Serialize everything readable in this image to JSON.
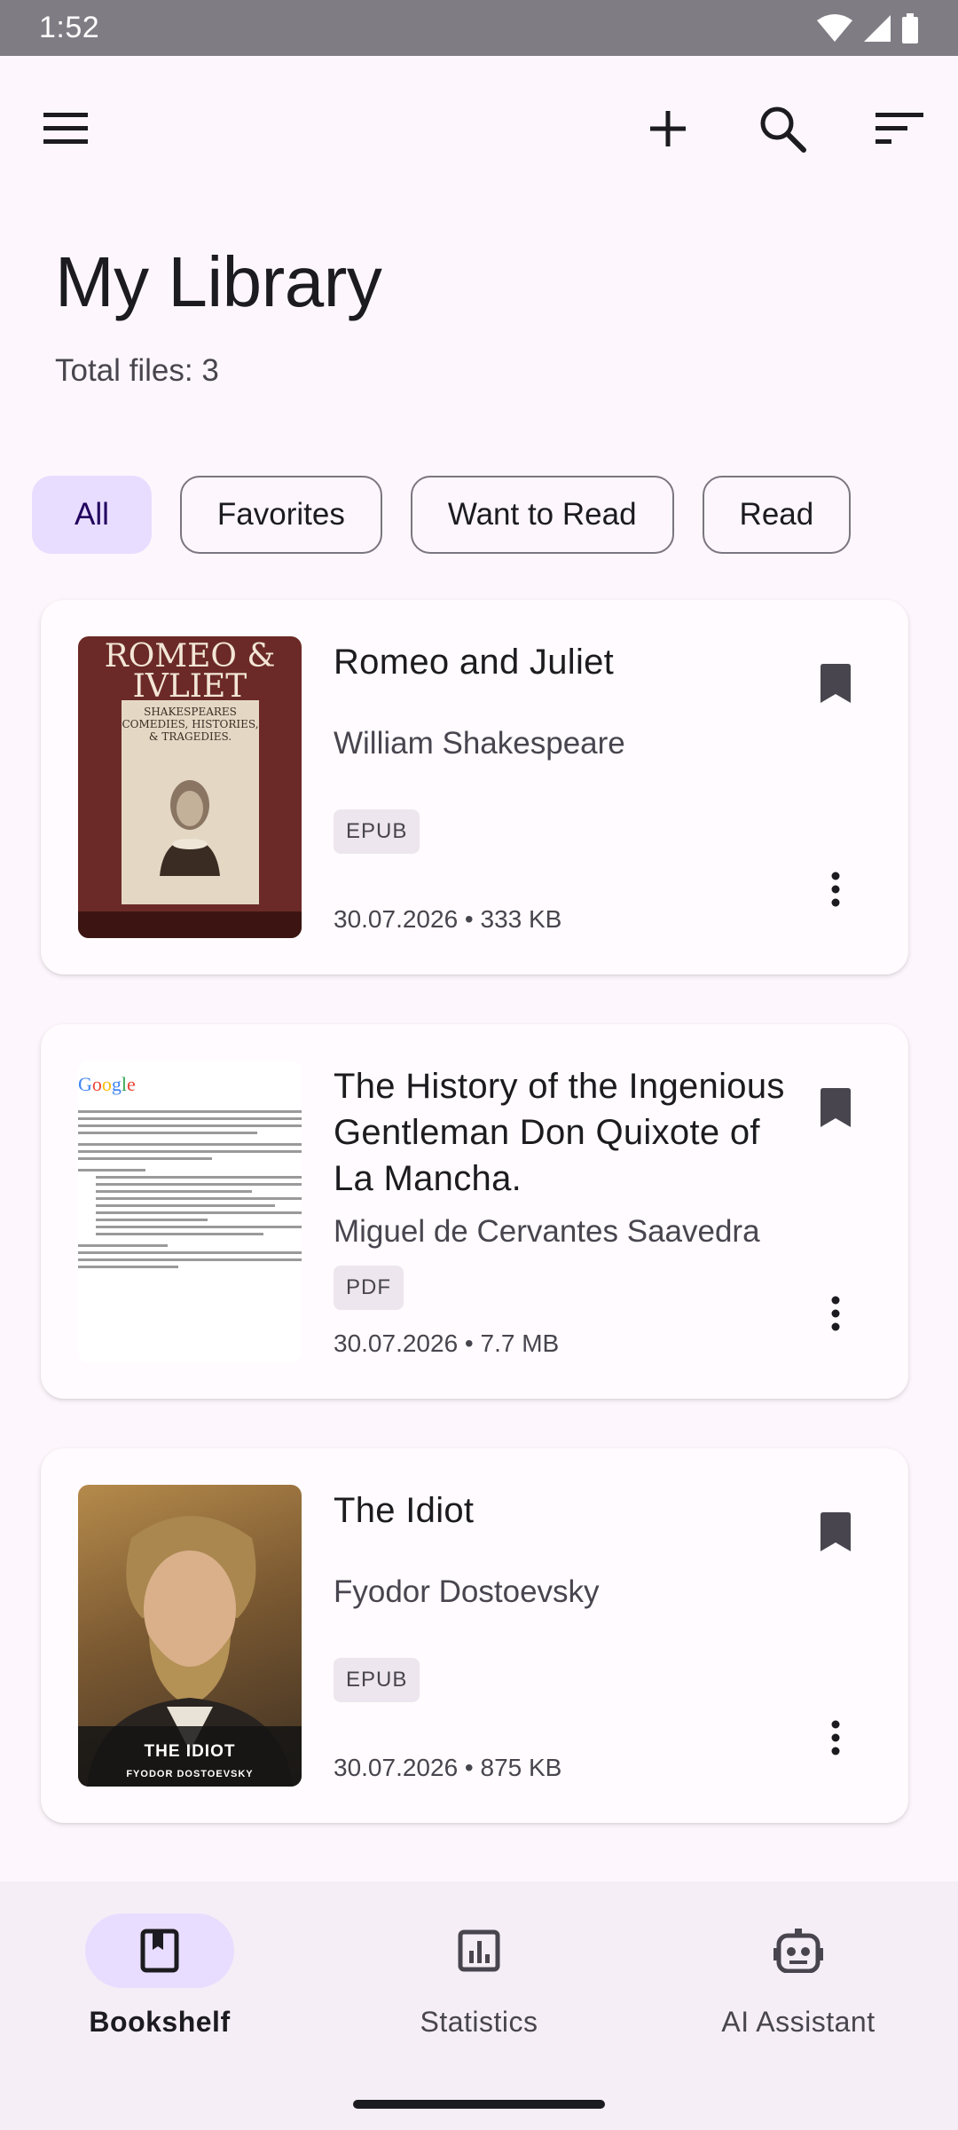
{
  "status_bar": {
    "time": "1:52"
  },
  "app_bar": {
    "menu_icon": "menu-icon",
    "add_icon": "add-icon",
    "search_icon": "search-icon",
    "sort_icon": "sort-icon"
  },
  "header": {
    "title": "My Library",
    "total_files": "Total files: 3"
  },
  "filters": [
    {
      "label": "All",
      "selected": true
    },
    {
      "label": "Favorites",
      "selected": false
    },
    {
      "label": "Want to Read",
      "selected": false
    },
    {
      "label": "Read",
      "selected": false
    }
  ],
  "books": [
    {
      "title": "Romeo and Juliet",
      "author": "William Shakespeare",
      "format": "EPUB",
      "meta": "30.07.2026 • 333 KB",
      "cover": {
        "heading": "ROMEO & IVLIET",
        "plate": "SHAKESPEARES COMEDIES, HISTORIES, & TRAGEDIES."
      }
    },
    {
      "title": "The History of the Ingenious Gentleman Don Quixote of La Mancha.",
      "author": "Miguel de Cervantes Saavedra",
      "format": "PDF",
      "meta": "30.07.2026 • 7.7 MB",
      "cover": {
        "logo": "Google"
      }
    },
    {
      "title": "The Idiot",
      "author": "Fyodor Dostoevsky",
      "format": "EPUB",
      "meta": "30.07.2026 • 875 KB",
      "cover": {
        "title": "THE IDIOT",
        "author": "FYODOR DOSTOEVSKY"
      }
    }
  ],
  "bottom_nav": [
    {
      "label": "Bookshelf",
      "icon": "book-icon",
      "active": true
    },
    {
      "label": "Statistics",
      "icon": "chart-icon",
      "active": false
    },
    {
      "label": "AI Assistant",
      "icon": "robot-icon",
      "active": false
    }
  ],
  "colors": {
    "accent": "#e8ddff",
    "background": "#fdf7fd",
    "status_bar": "#7f7c84"
  }
}
